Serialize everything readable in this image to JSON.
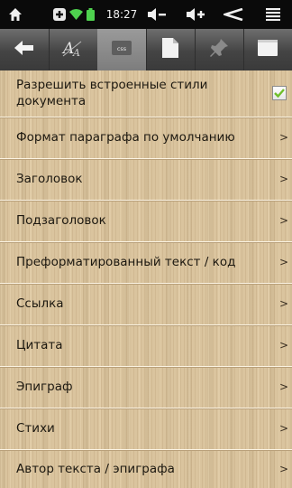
{
  "status_bar": {
    "time": "18:27",
    "icons": [
      "home-icon",
      "add-icon",
      "wifi-icon",
      "battery-icon",
      "volume-down-icon",
      "volume-up-icon",
      "back-icon",
      "menu-icon"
    ]
  },
  "toolbar": {
    "tabs": [
      {
        "name": "back-arrow-icon"
      },
      {
        "name": "font-settings-icon"
      },
      {
        "name": "css-icon",
        "label": "css"
      },
      {
        "name": "page-icon"
      },
      {
        "name": "pin-icon"
      },
      {
        "name": "blank-page-icon"
      }
    ],
    "selected_index": 2
  },
  "settings": {
    "items": [
      {
        "label": "Разрешить встроенные стили документа",
        "control": "checkbox",
        "checked": true
      },
      {
        "label": "Формат параграфа по умолчанию",
        "control": "chevron"
      },
      {
        "label": "Заголовок",
        "control": "chevron"
      },
      {
        "label": "Подзаголовок",
        "control": "chevron"
      },
      {
        "label": "Преформатированный текст / код",
        "control": "chevron"
      },
      {
        "label": "Ссылка",
        "control": "chevron"
      },
      {
        "label": "Цитата",
        "control": "chevron"
      },
      {
        "label": "Эпиграф",
        "control": "chevron"
      },
      {
        "label": "Стихи",
        "control": "chevron"
      },
      {
        "label": "Автор текста / эпиграфа",
        "control": "chevron"
      }
    ],
    "chevron": ">"
  },
  "colors": {
    "status_bar": "#0a0a0a",
    "toolbar": "#4a4a4a",
    "wood": "#dac49e",
    "check": "#6fbf2a"
  }
}
